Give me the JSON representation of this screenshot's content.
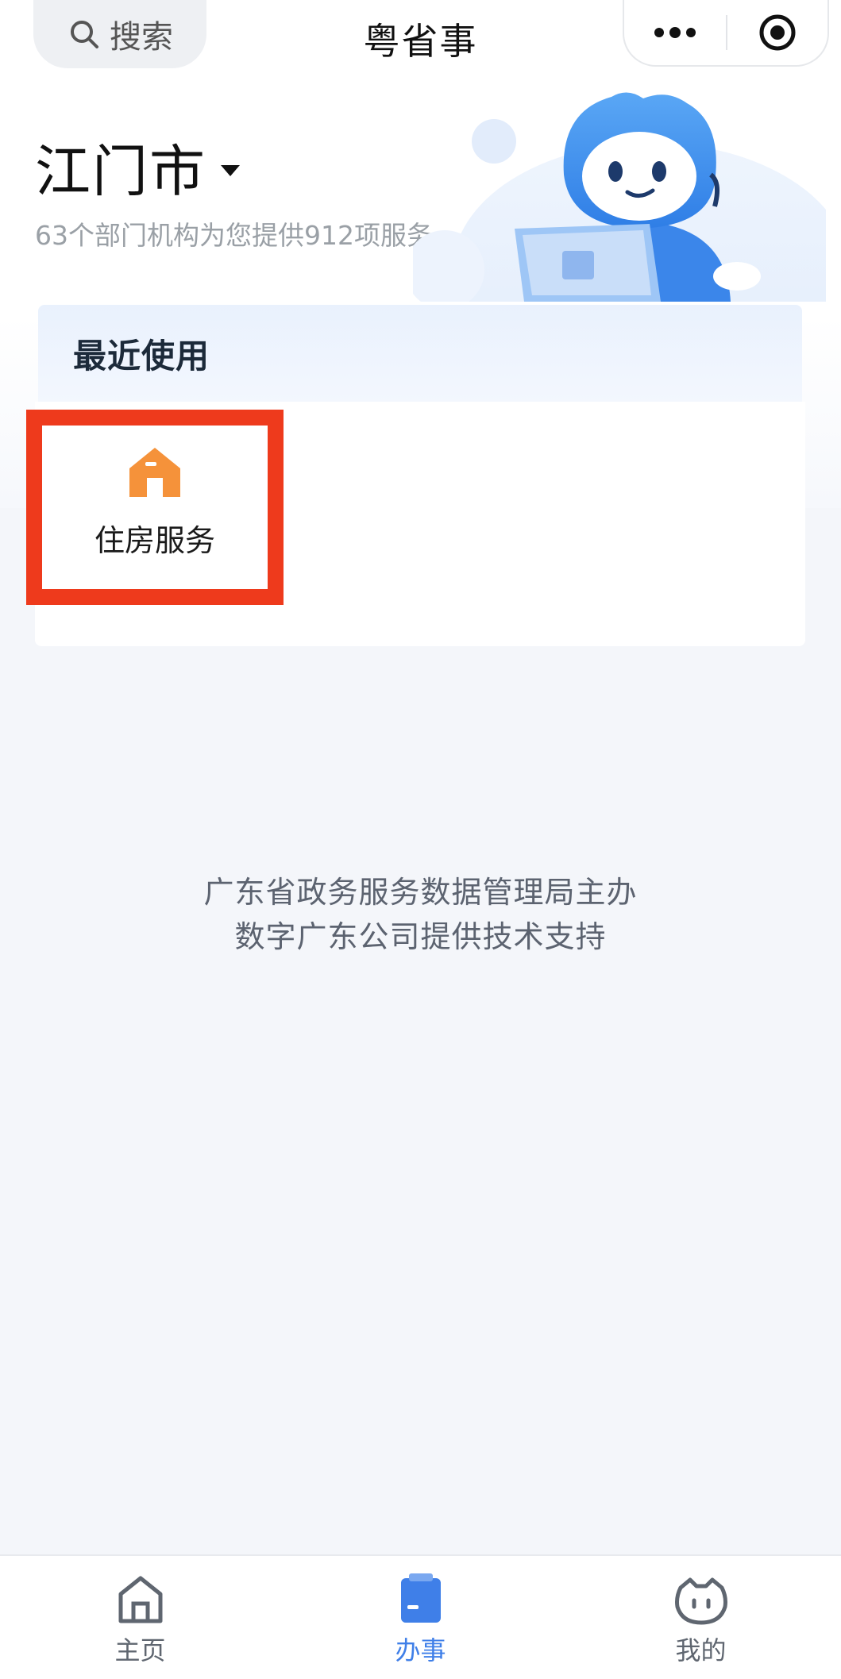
{
  "nav": {
    "search_label": "搜索",
    "title": "粤省事"
  },
  "city": {
    "name": "江门市",
    "summary": "63个部门机构为您提供912项服务"
  },
  "recent": {
    "title": "最近使用",
    "items": [
      {
        "label": "住房服务",
        "icon": "house-icon",
        "color": "#f5923a"
      }
    ]
  },
  "credits": {
    "line1": "广东省政务服务数据管理局主办",
    "line2": "数字广东公司提供技术支持"
  },
  "tabs": [
    {
      "label": "主页",
      "icon": "home-icon",
      "active": false
    },
    {
      "label": "办事",
      "icon": "clipboard-icon",
      "active": true
    },
    {
      "label": "我的",
      "icon": "profile-icon",
      "active": false
    }
  ],
  "colors": {
    "accent": "#3f7fe8",
    "highlight": "#ee3a1c",
    "service_icon": "#f5923a"
  }
}
